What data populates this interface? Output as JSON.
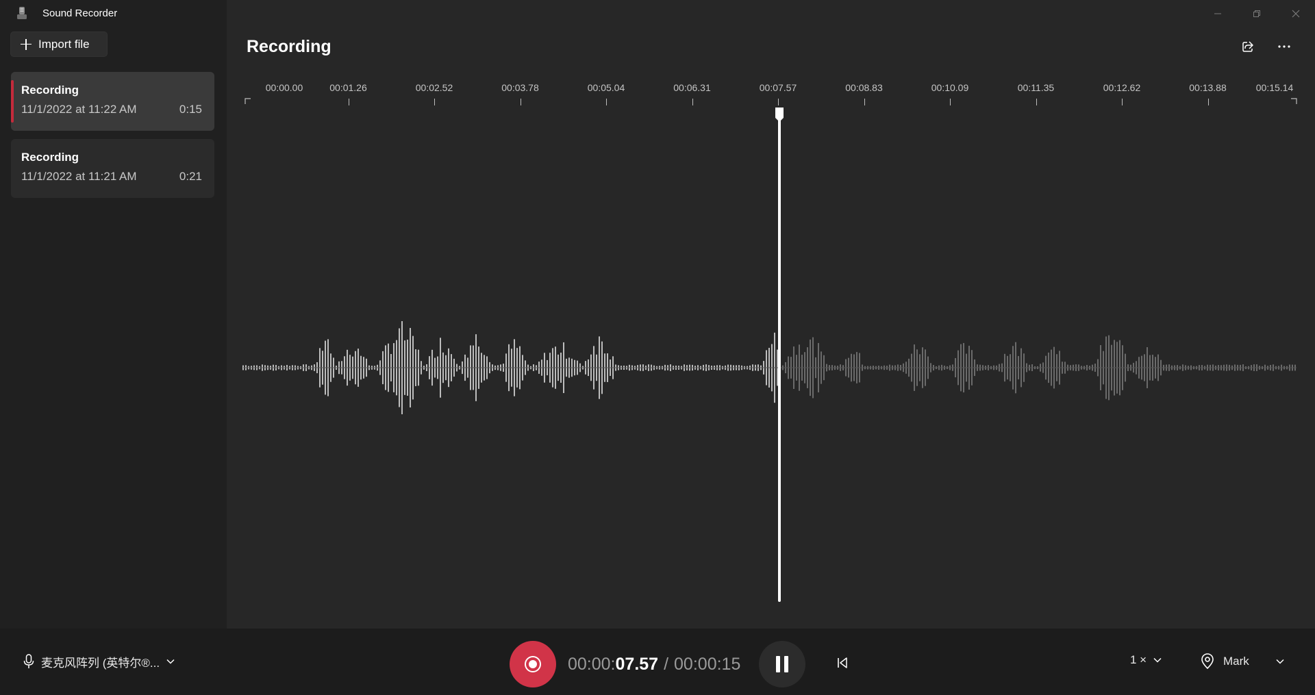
{
  "app": {
    "title": "Sound Recorder"
  },
  "sidebar": {
    "import_label": "Import file",
    "recordings": [
      {
        "name": "Recording",
        "date": "11/1/2022 at 11:22 AM",
        "duration": "0:15",
        "selected": true
      },
      {
        "name": "Recording",
        "date": "11/1/2022 at 11:21 AM",
        "duration": "0:21",
        "selected": false
      }
    ]
  },
  "main": {
    "title": "Recording",
    "timeline_ticks": [
      "00:00.00",
      "00:01.26",
      "00:02.52",
      "00:03.78",
      "00:05.04",
      "00:06.31",
      "00:07.57",
      "00:08.83",
      "00:10.09",
      "00:11.35",
      "00:12.62",
      "00:13.88",
      "00:15.14"
    ],
    "playhead_time": "00:07.57"
  },
  "player": {
    "mic_label": "麦克风阵列 (英特尔®...",
    "time_prefix": "00:00:",
    "time_current": "07.57",
    "time_separator": "/",
    "time_total": "00:00:15",
    "speed_label": "1 ×",
    "mark_label": "Mark"
  },
  "colors": {
    "accent": "#c42b3c",
    "record": "#d13448",
    "background": "#272727",
    "sidebar": "#202020",
    "bottom_bar": "#1c1c1c"
  }
}
